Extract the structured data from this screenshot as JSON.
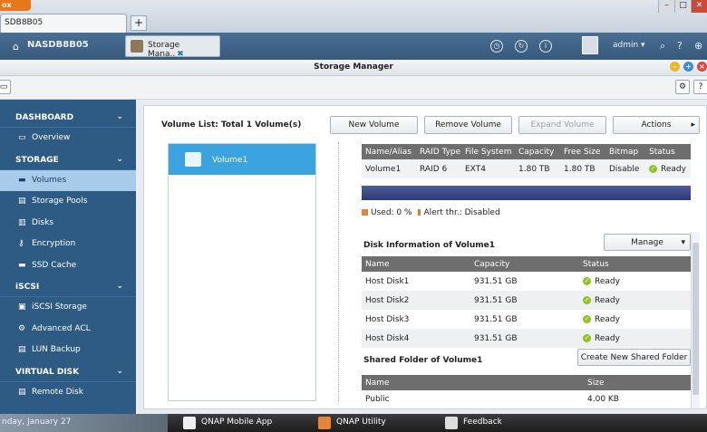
{
  "browser": {
    "button_label": "ox",
    "tab_title": "SDB8B05",
    "new_tab": "+",
    "win_min": "–",
    "win_max": "□",
    "win_close": "✕"
  },
  "topbar": {
    "nas_name": "NASDB8B05",
    "app_tab_label": "Storage Mana..",
    "app_tab_close": "✖",
    "user": "admin ▾",
    "icons": [
      "clock-icon",
      "refresh-icon",
      "info-icon",
      "search-icon",
      "help-icon",
      "globe-icon"
    ]
  },
  "window": {
    "title": "Storage Manager",
    "btn_min": "–",
    "btn_max": "+",
    "btn_close": "×",
    "help": "?"
  },
  "sidebar": {
    "sections": [
      {
        "label": "DASHBOARD",
        "items": [
          {
            "label": "Overview",
            "icon": "monitor-icon"
          }
        ]
      },
      {
        "label": "STORAGE",
        "items": [
          {
            "label": "Volumes",
            "icon": "volume-icon",
            "active": true
          },
          {
            "label": "Storage Pools",
            "icon": "pool-icon"
          },
          {
            "label": "Disks",
            "icon": "disk-icon"
          },
          {
            "label": "Encryption",
            "icon": "key-icon"
          },
          {
            "label": "SSD Cache",
            "icon": "ssd-icon"
          }
        ]
      },
      {
        "label": "iSCSI",
        "items": [
          {
            "label": "iSCSI Storage",
            "icon": "iscsi-icon"
          },
          {
            "label": "Advanced ACL",
            "icon": "gear-icon"
          },
          {
            "label": "LUN Backup",
            "icon": "backup-icon"
          }
        ]
      },
      {
        "label": "VIRTUAL DISK",
        "items": [
          {
            "label": "Remote Disk",
            "icon": "remote-disk-icon"
          }
        ]
      }
    ]
  },
  "main": {
    "volume_list_title": "Volume List: Total 1 Volume(s)",
    "buttons": {
      "new_volume": "New Volume",
      "remove_volume": "Remove Volume",
      "expand_volume": "Expand Volume",
      "actions": "Actions"
    },
    "selected_volume": "Volume1",
    "volume_table": {
      "headers": [
        "Name/Alias",
        "RAID Type",
        "File System",
        "Capacity",
        "Free Size",
        "Bitmap",
        "Status"
      ],
      "row": [
        "Volume1",
        "RAID 6",
        "EXT4",
        "1.80 TB",
        "1.80 TB",
        "Disable",
        "Ready"
      ]
    },
    "usage": {
      "used_label": "Used: 0 %",
      "alert_label": "Alert thr.: Disabled",
      "used_fraction": 0.0
    },
    "disk_info": {
      "title": "Disk Information of Volume1",
      "manage_label": "Manage",
      "headers": [
        "Name",
        "Capacity",
        "Status"
      ],
      "rows": [
        [
          "Host Disk1",
          "931.51 GB",
          "Ready"
        ],
        [
          "Host Disk2",
          "931.51 GB",
          "Ready"
        ],
        [
          "Host Disk3",
          "931.51 GB",
          "Ready"
        ],
        [
          "Host Disk4",
          "931.51 GB",
          "Ready"
        ]
      ]
    },
    "shared_folder": {
      "title": "Shared Folder of Volume1",
      "create_label": "Create New Shared Folder",
      "headers": [
        "Name",
        "Size"
      ],
      "rows": [
        [
          "Public",
          "4.00 KB"
        ]
      ]
    }
  },
  "taskbar": {
    "left_text": "nday, January 27",
    "items": [
      "QNAP Mobile App",
      "QNAP Utility",
      "Feedback"
    ]
  },
  "colors": {
    "sidebar_bg": "#2e5b84",
    "active_item": "#a7cbe8",
    "selected_volume": "#3aa3e0",
    "header_gray": "#6e6e6e"
  }
}
